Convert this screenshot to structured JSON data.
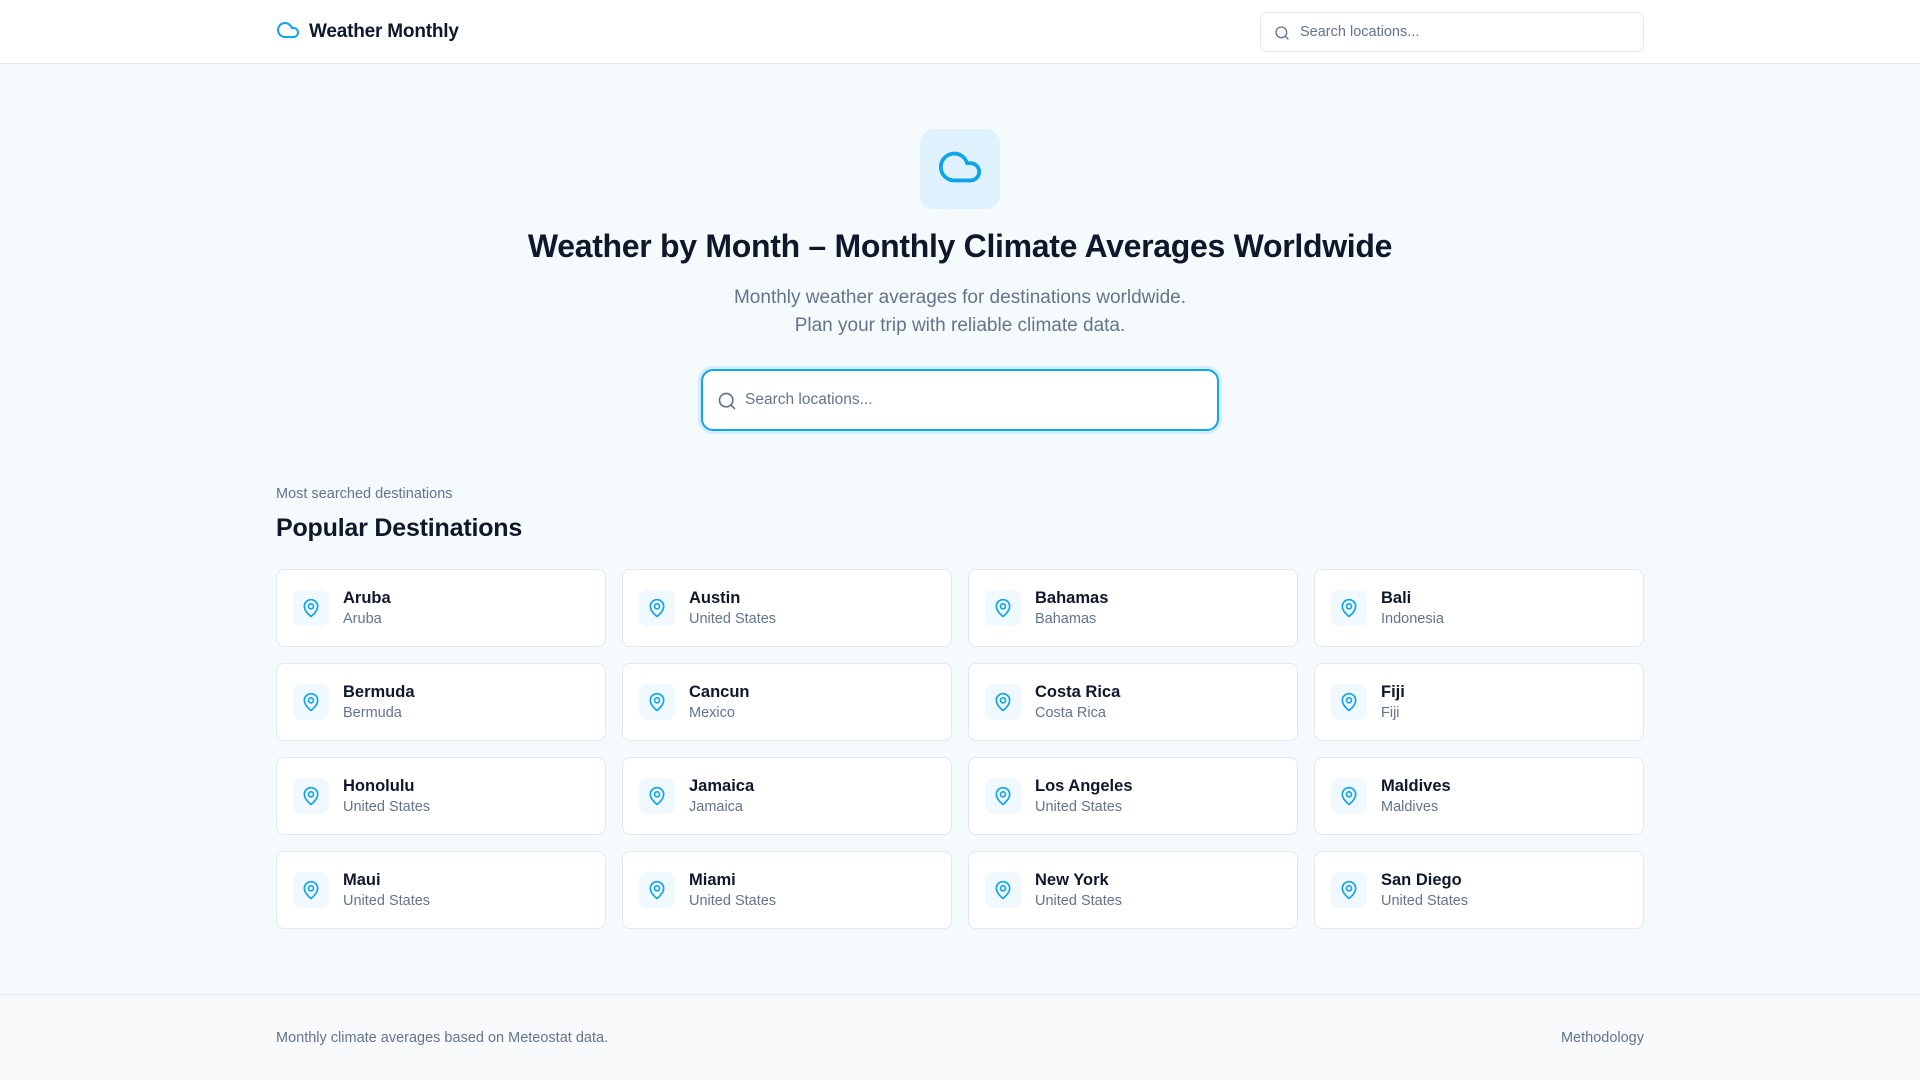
{
  "header": {
    "brand": "Weather Monthly",
    "search_placeholder": "Search locations..."
  },
  "hero": {
    "title": "Weather by Month – Monthly Climate Averages Worldwide",
    "subtitle_line1": "Monthly weather averages for destinations worldwide.",
    "subtitle_line2": "Plan your trip with reliable climate data.",
    "search_placeholder": "Search locations..."
  },
  "destinations": {
    "eyebrow": "Most searched destinations",
    "title": "Popular Destinations",
    "items": [
      {
        "name": "Aruba",
        "country": "Aruba"
      },
      {
        "name": "Austin",
        "country": "United States"
      },
      {
        "name": "Bahamas",
        "country": "Bahamas"
      },
      {
        "name": "Bali",
        "country": "Indonesia"
      },
      {
        "name": "Bermuda",
        "country": "Bermuda"
      },
      {
        "name": "Cancun",
        "country": "Mexico"
      },
      {
        "name": "Costa Rica",
        "country": "Costa Rica"
      },
      {
        "name": "Fiji",
        "country": "Fiji"
      },
      {
        "name": "Honolulu",
        "country": "United States"
      },
      {
        "name": "Jamaica",
        "country": "Jamaica"
      },
      {
        "name": "Los Angeles",
        "country": "United States"
      },
      {
        "name": "Maldives",
        "country": "Maldives"
      },
      {
        "name": "Maui",
        "country": "United States"
      },
      {
        "name": "Miami",
        "country": "United States"
      },
      {
        "name": "New York",
        "country": "United States"
      },
      {
        "name": "San Diego",
        "country": "United States"
      }
    ]
  },
  "footer": {
    "text": "Monthly climate averages based on Meteostat data.",
    "link": "Methodology"
  },
  "colors": {
    "accent": "#0ea5e9",
    "text": "#0f172a",
    "muted": "#64748b",
    "border": "#e2e8f0",
    "icon_bg": "#e0f2fe"
  },
  "icons": {
    "brand": "cloud-icon",
    "search": "search-icon",
    "hero": "cloud-icon",
    "destination": "map-pin-icon"
  }
}
